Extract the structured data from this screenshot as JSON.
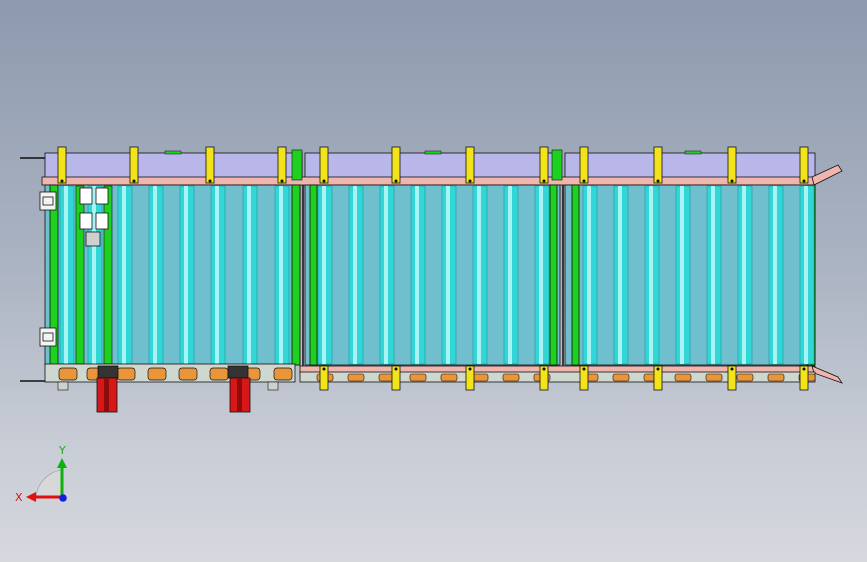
{
  "triad": {
    "x_label": "X",
    "y_label": "Y",
    "x_color": "#e01010",
    "y_color": "#10b010",
    "z_color": "#1020e0"
  },
  "colors": {
    "roller": "#33d6d6",
    "roller_highlight": "#a8f4f4",
    "side_frame": "#1fd11f",
    "side_plate": "#b9b6ea",
    "rail": "#f0b6ae",
    "bracket": "#f2e31a",
    "chain_sprocket": "#e9953a",
    "cylinder": "#d81818",
    "outline": "#111111"
  }
}
